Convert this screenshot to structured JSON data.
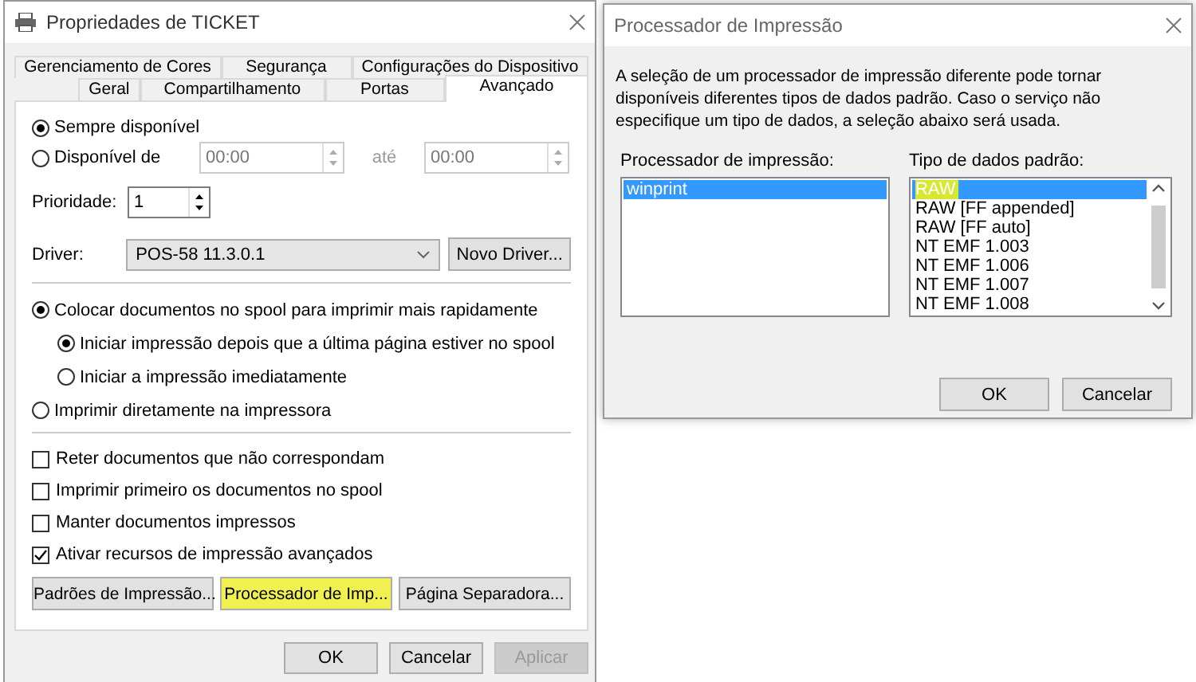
{
  "properties_window": {
    "title": "Propriedades de TICKET",
    "tab_rows": [
      [
        {
          "label": "Gerenciamento de Cores",
          "selected": false
        },
        {
          "label": "Segurança",
          "selected": false
        },
        {
          "label": "Configurações do Dispositivo",
          "selected": false
        }
      ],
      [
        {
          "label": "Geral",
          "selected": false
        },
        {
          "label": "Compartilhamento",
          "selected": false
        },
        {
          "label": "Portas",
          "selected": false
        },
        {
          "label": "Avançado",
          "selected": true
        }
      ]
    ],
    "availability": [
      {
        "label": "Sempre disponível",
        "selected": true
      },
      {
        "label": "Disponível de",
        "selected": false
      }
    ],
    "from_time": {
      "value": "00:00",
      "disabled": true
    },
    "to_label": "até",
    "to_time": {
      "value": "00:00",
      "disabled": true
    },
    "priority": {
      "label": "Prioridade:",
      "value": "1"
    },
    "driver": {
      "label": "Driver:",
      "value": "POS-58 11.3.0.1",
      "button": "Novo Driver..."
    },
    "spool_options": [
      {
        "label": "Colocar documentos no spool para imprimir mais rapidamente",
        "selected": true,
        "children": [
          {
            "label": "Iniciar impressão depois que a última página estiver no spool",
            "selected": true
          },
          {
            "label": "Iniciar a impressão imediatamente",
            "selected": false
          }
        ]
      },
      {
        "label": "Imprimir diretamente na impressora",
        "selected": false
      }
    ],
    "checkboxes": [
      {
        "label": "Reter documentos que não correspondam",
        "checked": false
      },
      {
        "label": "Imprimir primeiro os documentos no spool",
        "checked": false
      },
      {
        "label": "Manter documentos impressos",
        "checked": false
      },
      {
        "label": "Ativar recursos de impressão avançados",
        "checked": true
      }
    ],
    "panel_buttons": [
      {
        "label": "Padrões de Impressão...",
        "highlighted": false
      },
      {
        "label": "Processador de Imp...",
        "highlighted": true
      },
      {
        "label": "Página Separadora...",
        "highlighted": false
      }
    ],
    "buttons": [
      {
        "label": "OK",
        "disabled": false
      },
      {
        "label": "Cancelar",
        "disabled": false
      },
      {
        "label": "Aplicar",
        "disabled": true
      }
    ]
  },
  "processor_window": {
    "title": "Processador de Impressão",
    "description": "A seleção de um processador de impressão diferente pode tornar disponíveis diferentes tipos de dados padrão. Caso o serviço não especifique um tipo de dados, a seleção abaixo será usada.",
    "processor_list": {
      "label": "Processador de impressão:",
      "items": [
        {
          "label": "winprint",
          "selected": true,
          "highlighted": false
        }
      ]
    },
    "datatype_list": {
      "label": "Tipo de dados padrão:",
      "items": [
        {
          "label": "RAW",
          "selected": true,
          "highlighted": true
        },
        {
          "label": "RAW [FF appended]",
          "selected": false,
          "highlighted": false
        },
        {
          "label": "RAW [FF auto]",
          "selected": false,
          "highlighted": false
        },
        {
          "label": "NT EMF 1.003",
          "selected": false,
          "highlighted": false
        },
        {
          "label": "NT EMF 1.006",
          "selected": false,
          "highlighted": false
        },
        {
          "label": "NT EMF 1.007",
          "selected": false,
          "highlighted": false
        },
        {
          "label": "NT EMF 1.008",
          "selected": false,
          "highlighted": false
        }
      ]
    },
    "buttons": [
      {
        "label": "OK",
        "disabled": false
      },
      {
        "label": "Cancelar",
        "disabled": false
      }
    ]
  }
}
